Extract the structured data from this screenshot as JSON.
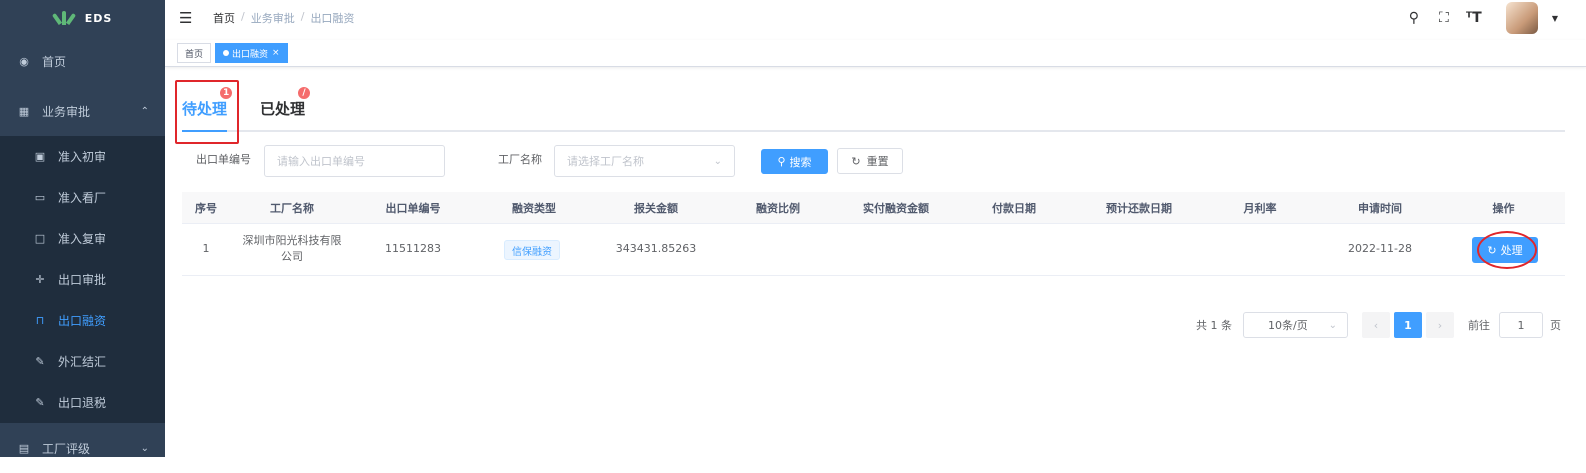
{
  "app": {
    "logo_text": "EDS"
  },
  "sidebar": {
    "items": [
      {
        "label": "首页",
        "icon": "dashboard-icon"
      },
      {
        "label": "业务审批",
        "icon": "table-icon",
        "expanded": true,
        "children": [
          {
            "label": "准入初审",
            "icon": "edit-icon"
          },
          {
            "label": "准入看厂",
            "icon": "monitor-icon"
          },
          {
            "label": "准入复审",
            "icon": "document-icon"
          },
          {
            "label": "出口审批",
            "icon": "move-icon"
          },
          {
            "label": "出口融资",
            "icon": "form-icon",
            "active": true
          },
          {
            "label": "外汇结汇",
            "icon": "edit-doc-icon"
          },
          {
            "label": "出口退税",
            "icon": "edit-doc-icon"
          }
        ]
      },
      {
        "label": "工厂评级",
        "icon": "monitor-icon"
      }
    ]
  },
  "header": {
    "breadcrumb": [
      "首页",
      "业务审批",
      "出口融资"
    ],
    "separator": "/"
  },
  "tags": [
    {
      "label": "首页",
      "active": false
    },
    {
      "label": "出口融资",
      "active": true,
      "close": "×"
    }
  ],
  "tabs": [
    {
      "label": "待处理",
      "badge": "1",
      "active": true
    },
    {
      "label": "已处理",
      "badge": "/",
      "active": false
    }
  ],
  "search": {
    "export_no_label": "出口单编号",
    "export_no_placeholder": "请输入出口单编号",
    "factory_label": "工厂名称",
    "factory_placeholder": "请选择工厂名称",
    "search_button": "搜索",
    "reset_button": "重置"
  },
  "table": {
    "columns": [
      "序号",
      "工厂名称",
      "出口单编号",
      "融资类型",
      "报关金额",
      "融资比例",
      "实付融资金额",
      "付款日期",
      "预计还款日期",
      "月利率",
      "申请时间",
      "操作"
    ],
    "rows": [
      {
        "index": "1",
        "factory": "深圳市阳光科技有限公司",
        "export_no": "11511283",
        "finance_type": "信保融资",
        "amount": "343431.85263",
        "ratio": "",
        "paid": "",
        "pay_date": "",
        "repay_date": "",
        "rate": "",
        "apply_time": "2022-11-28",
        "action": "处理"
      }
    ]
  },
  "pagination": {
    "total": "共 1 条",
    "page_size": "10条/页",
    "prev": "‹",
    "current": "1",
    "next": "›",
    "jump_prefix": "前往",
    "jump_value": "1",
    "jump_suffix": "页"
  },
  "colors": {
    "sidebar_bg": "#304156",
    "submenu_bg": "#1f2d3d",
    "primary": "#409eff",
    "badge": "#f56c6c",
    "annotation_red": "#e0262b"
  }
}
